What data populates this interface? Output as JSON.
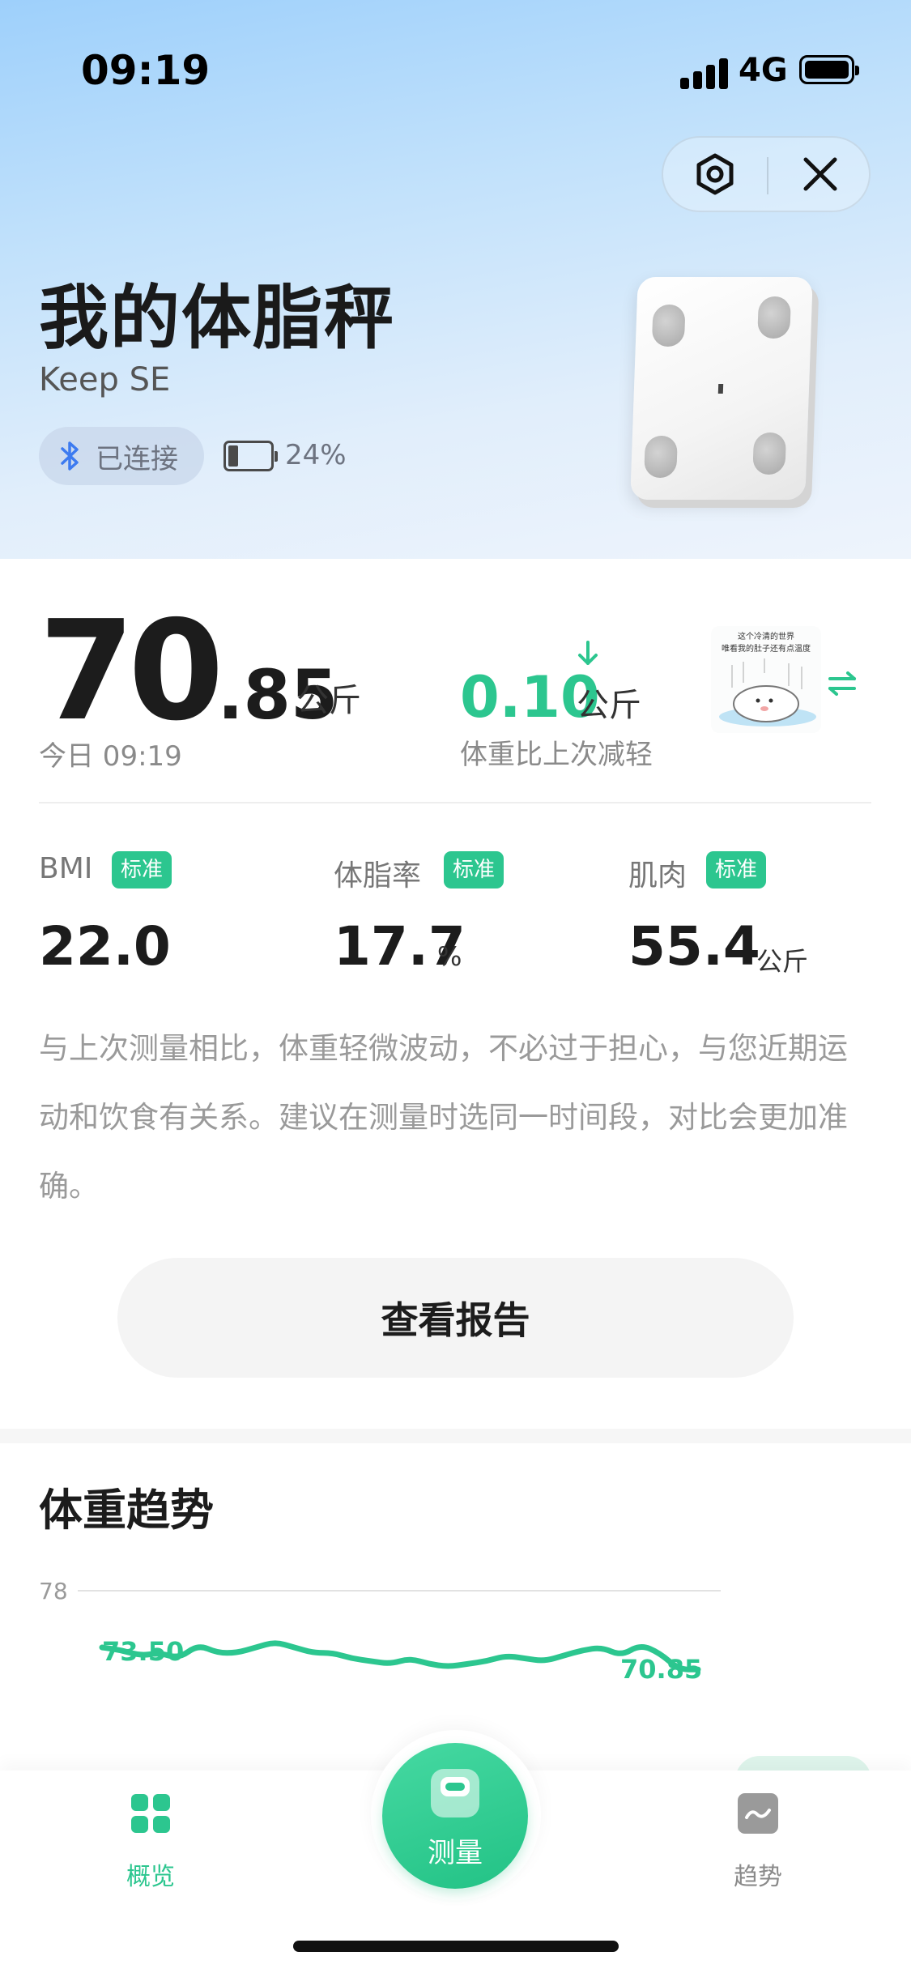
{
  "status_bar": {
    "time": "09:19",
    "network": "4G"
  },
  "header": {
    "title": "我的体脂秤",
    "model": "Keep SE",
    "connection": "已连接",
    "battery_percent": "24%",
    "battery_level": 0.24
  },
  "weight": {
    "integer": "70",
    "decimal": ".85",
    "unit": "公斤",
    "timestamp": "今日 09:19",
    "change_value": "0.10",
    "change_unit": "公斤",
    "change_note": "体重比上次减轻",
    "sticker_text_line1": "这个冷清的世界",
    "sticker_text_line2": "唯看我的肚子还有点温度"
  },
  "metrics": [
    {
      "label": "BMI",
      "badge": "标准",
      "value": "22.0",
      "unit": ""
    },
    {
      "label": "体脂率",
      "badge": "标准",
      "value": "17.7",
      "unit": "%"
    },
    {
      "label": "肌肉",
      "badge": "标准",
      "value": "55.4",
      "unit": "公斤"
    }
  ],
  "description": "与上次测量相比，体重轻微波动，不必过于担心，与您近期运动和饮食有关系。建议在测量时选同一时间段，对比会更加准确。",
  "report_button": "查看报告",
  "trend": {
    "title": "体重趋势",
    "y_tick": "78",
    "start_label": "73.50",
    "end_label": "70.85"
  },
  "chart_data": {
    "type": "line",
    "title": "体重趋势",
    "y_ticks": [
      78
    ],
    "series": [
      {
        "values": [
          73.5,
          73.4,
          73.2,
          73.3,
          73.1,
          73.6,
          73.3,
          73.3,
          73.5,
          73.7,
          73.5,
          73.3,
          73.3,
          73.1,
          73.0,
          72.9,
          73.1,
          72.9,
          72.8,
          72.9,
          73.0,
          73.2,
          73.1,
          73.0,
          73.2,
          73.4,
          73.5,
          73.2,
          73.6,
          73.3,
          72.7,
          72.7
        ],
        "start_label": "73.50",
        "end_label": "70.85"
      }
    ],
    "grid": "single horizontal line at 78"
  },
  "nav": {
    "overview": "概览",
    "measure": "测量",
    "trend": "趋势"
  },
  "colors": {
    "accent": "#2cc68f",
    "header_gradient_top": "#9ed0fb",
    "text_muted": "#8a8a8a"
  }
}
